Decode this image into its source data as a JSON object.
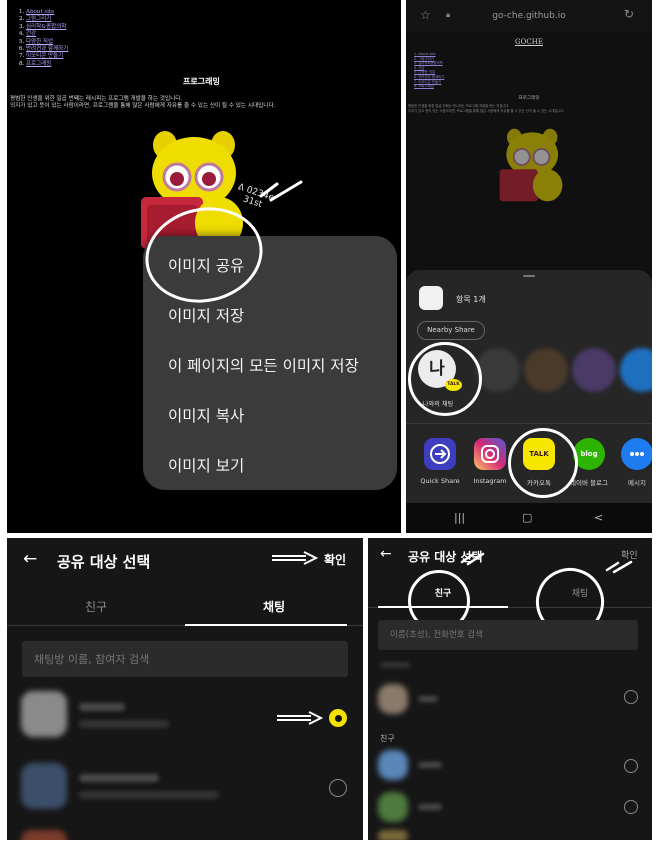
{
  "panel1": {
    "toc": [
      {
        "num": "1.",
        "label": "About site"
      },
      {
        "num": "2.",
        "label": "그림그리기"
      },
      {
        "num": "3.",
        "label": "심리학&종합의학"
      },
      {
        "num": "4.",
        "label": "건강"
      },
      {
        "num": "5.",
        "label": "다양한 직업"
      },
      {
        "num": "6.",
        "label": "반려견과 함께하기"
      },
      {
        "num": "7.",
        "label": "이모티콘 만들기"
      },
      {
        "num": "8.",
        "label": "프로그래밍"
      }
    ],
    "heading": "프로그래밍",
    "body_line1": "평범한 인생을 위한 일곱 번째는 레시피는 프로그램 개발을 하는 것입니다.",
    "body_line2": "의지가 있고 뜻이 있는 사람이라면, 프로그램을 통해 많은 사람에게 자유를 줄 수 있는 신이 될 수 있는 시대입니다.",
    "context_menu": [
      "이미지 공유",
      "이미지 저장",
      "이 페이지의 모든 이미지 저장",
      "이미지 복사",
      "이미지 보기"
    ]
  },
  "panel2": {
    "url": "go-che.github.io",
    "site_title": "GOCHE",
    "toc": [
      "1. About site",
      "2. 그림그리기",
      "3. 심리학&종합의학",
      "4. 건강",
      "5. 다양한 직업",
      "6. 반려견과 함께하기",
      "7. 이모티콘 만들기",
      "8. 프로그래밍"
    ],
    "heading": "프로그래밍",
    "body_line1": "평범한 인생을 위한 일곱 번째는 레시피는 프로그램 개발을 하는 것입니다.",
    "body_line2": "의지가 있고 뜻이 있는 사람이라면, 프로그램을 통해 많은 사람에게 자유를 줄 수 있는 신이 될 수 있는 시대입니다.",
    "share": {
      "item_count": "항목 1개",
      "nearby_share": "Nearby Share",
      "me_glyph": "나",
      "talk_badge": "TALK",
      "me_label": "나와의 채팅",
      "apps": [
        {
          "label": "Quick Share",
          "color": "#3d3dbf",
          "icon": "quick-share-icon"
        },
        {
          "label": "Instagram",
          "color": "#d62976",
          "icon": "instagram-icon"
        },
        {
          "label": "카카오톡",
          "color": "#f7e600",
          "icon": "kakaotalk-icon"
        },
        {
          "label": "네이버 블로그",
          "color": "#2db400",
          "icon": "naver-blog-icon"
        },
        {
          "label": "메시지",
          "color": "#1f7cf0",
          "icon": "message-icon"
        }
      ],
      "app_glyphs": [
        "TALK",
        "blog"
      ]
    },
    "nav": [
      "|||",
      "▢",
      "<"
    ]
  },
  "panel3": {
    "back": "←",
    "title": "공유 대상 선택",
    "confirm": "확인",
    "tabs": [
      "친구",
      "채팅"
    ],
    "active_tab": "채팅",
    "search_placeholder": "채팅방 이름, 참여자 검색"
  },
  "panel4": {
    "back": "←",
    "title": "공유 대상 선택",
    "confirm": "확인",
    "tabs": [
      "친구",
      "채팅"
    ],
    "active_tab": "친구",
    "search_placeholder": "이름(초성), 전화번호 검색",
    "section_friends": "친구"
  },
  "colors": {
    "kakao_yellow": "#f7e600",
    "sheet_bg": "#262626",
    "menu_bg": "#3b3b3b"
  }
}
